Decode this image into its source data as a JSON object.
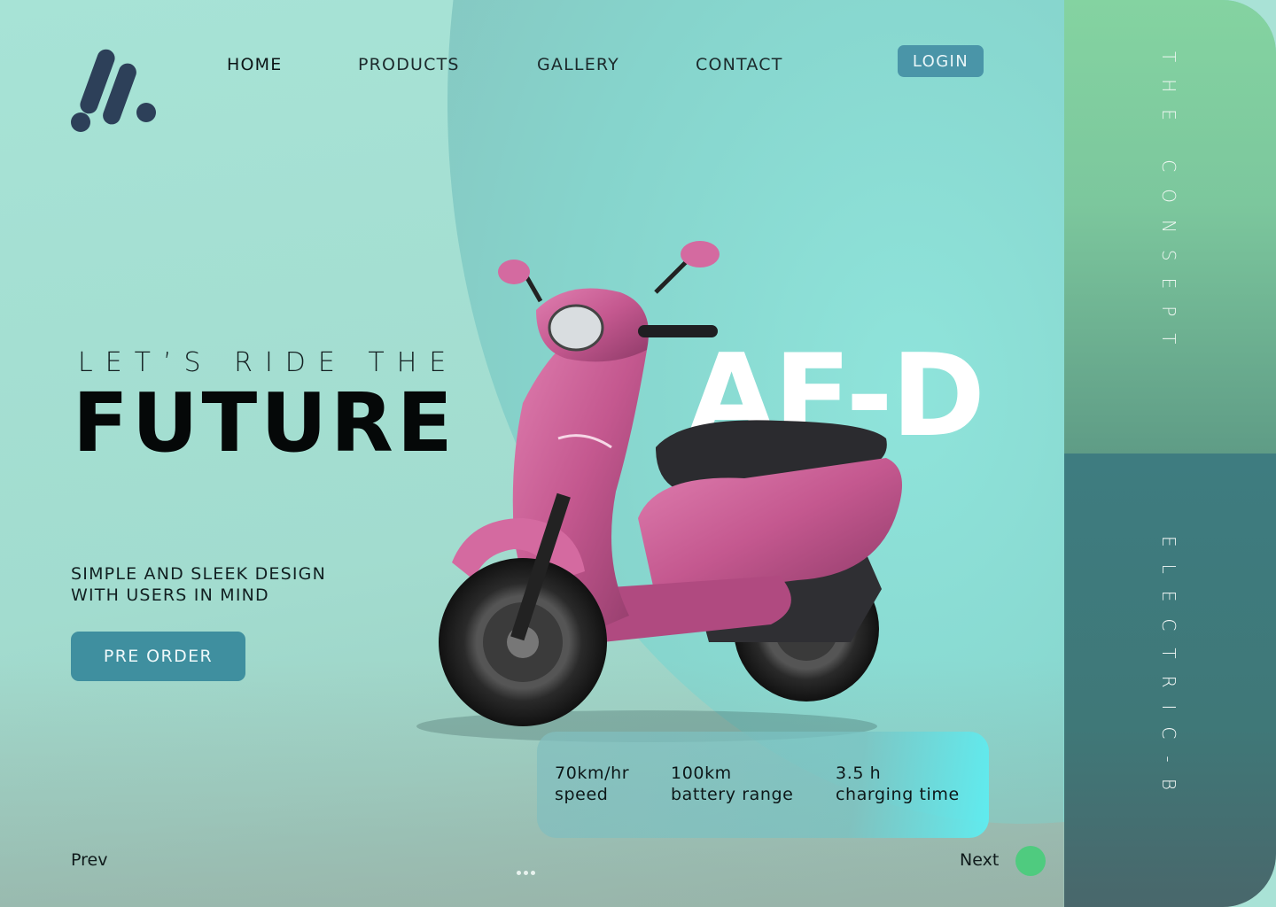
{
  "nav": {
    "items": [
      "HOME",
      "PRODUCTS",
      "GALLERY",
      "CONTACT"
    ],
    "login": "LOGIN"
  },
  "hero": {
    "eyebrow": "LET’S RIDE THE",
    "title": "FUTURE",
    "model": "AF-D",
    "tagline": [
      "SIMPLE AND SLEEK DESIGN",
      "WITH USERS IN MIND"
    ],
    "cta": "PRE ORDER"
  },
  "specs": [
    {
      "value": "70km/hr",
      "label": "speed"
    },
    {
      "value": "100km",
      "label": "battery range"
    },
    {
      "value": "3.5 h",
      "label": "charging time"
    }
  ],
  "side": {
    "top_text": "THE CONSEPT",
    "bottom_text": "ELECTRIC-B"
  },
  "pager": {
    "prev": "Prev",
    "next": "Next"
  },
  "colors": {
    "accent": "#3f8f9f",
    "next_dot": "#4fcb7f",
    "scooter": "#c4588f",
    "side_top": "#84d3a1",
    "side_bottom": "#3e7c80"
  }
}
